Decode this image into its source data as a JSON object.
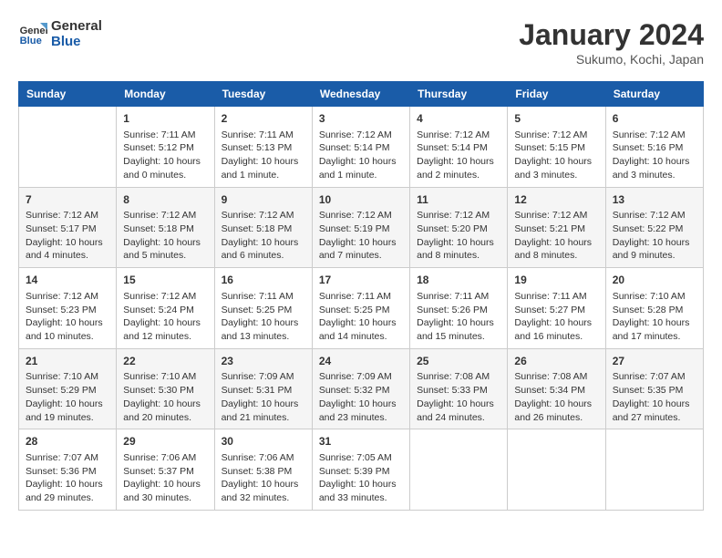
{
  "header": {
    "logo_line1": "General",
    "logo_line2": "Blue",
    "main_title": "January 2024",
    "subtitle": "Sukumo, Kochi, Japan"
  },
  "days_of_week": [
    "Sunday",
    "Monday",
    "Tuesday",
    "Wednesday",
    "Thursday",
    "Friday",
    "Saturday"
  ],
  "weeks": [
    [
      {
        "day": "",
        "info": ""
      },
      {
        "day": "1",
        "info": "Sunrise: 7:11 AM\nSunset: 5:12 PM\nDaylight: 10 hours\nand 0 minutes."
      },
      {
        "day": "2",
        "info": "Sunrise: 7:11 AM\nSunset: 5:13 PM\nDaylight: 10 hours\nand 1 minute."
      },
      {
        "day": "3",
        "info": "Sunrise: 7:12 AM\nSunset: 5:14 PM\nDaylight: 10 hours\nand 1 minute."
      },
      {
        "day": "4",
        "info": "Sunrise: 7:12 AM\nSunset: 5:14 PM\nDaylight: 10 hours\nand 2 minutes."
      },
      {
        "day": "5",
        "info": "Sunrise: 7:12 AM\nSunset: 5:15 PM\nDaylight: 10 hours\nand 3 minutes."
      },
      {
        "day": "6",
        "info": "Sunrise: 7:12 AM\nSunset: 5:16 PM\nDaylight: 10 hours\nand 3 minutes."
      }
    ],
    [
      {
        "day": "7",
        "info": "Sunrise: 7:12 AM\nSunset: 5:17 PM\nDaylight: 10 hours\nand 4 minutes."
      },
      {
        "day": "8",
        "info": "Sunrise: 7:12 AM\nSunset: 5:18 PM\nDaylight: 10 hours\nand 5 minutes."
      },
      {
        "day": "9",
        "info": "Sunrise: 7:12 AM\nSunset: 5:18 PM\nDaylight: 10 hours\nand 6 minutes."
      },
      {
        "day": "10",
        "info": "Sunrise: 7:12 AM\nSunset: 5:19 PM\nDaylight: 10 hours\nand 7 minutes."
      },
      {
        "day": "11",
        "info": "Sunrise: 7:12 AM\nSunset: 5:20 PM\nDaylight: 10 hours\nand 8 minutes."
      },
      {
        "day": "12",
        "info": "Sunrise: 7:12 AM\nSunset: 5:21 PM\nDaylight: 10 hours\nand 8 minutes."
      },
      {
        "day": "13",
        "info": "Sunrise: 7:12 AM\nSunset: 5:22 PM\nDaylight: 10 hours\nand 9 minutes."
      }
    ],
    [
      {
        "day": "14",
        "info": "Sunrise: 7:12 AM\nSunset: 5:23 PM\nDaylight: 10 hours\nand 10 minutes."
      },
      {
        "day": "15",
        "info": "Sunrise: 7:12 AM\nSunset: 5:24 PM\nDaylight: 10 hours\nand 12 minutes."
      },
      {
        "day": "16",
        "info": "Sunrise: 7:11 AM\nSunset: 5:25 PM\nDaylight: 10 hours\nand 13 minutes."
      },
      {
        "day": "17",
        "info": "Sunrise: 7:11 AM\nSunset: 5:25 PM\nDaylight: 10 hours\nand 14 minutes."
      },
      {
        "day": "18",
        "info": "Sunrise: 7:11 AM\nSunset: 5:26 PM\nDaylight: 10 hours\nand 15 minutes."
      },
      {
        "day": "19",
        "info": "Sunrise: 7:11 AM\nSunset: 5:27 PM\nDaylight: 10 hours\nand 16 minutes."
      },
      {
        "day": "20",
        "info": "Sunrise: 7:10 AM\nSunset: 5:28 PM\nDaylight: 10 hours\nand 17 minutes."
      }
    ],
    [
      {
        "day": "21",
        "info": "Sunrise: 7:10 AM\nSunset: 5:29 PM\nDaylight: 10 hours\nand 19 minutes."
      },
      {
        "day": "22",
        "info": "Sunrise: 7:10 AM\nSunset: 5:30 PM\nDaylight: 10 hours\nand 20 minutes."
      },
      {
        "day": "23",
        "info": "Sunrise: 7:09 AM\nSunset: 5:31 PM\nDaylight: 10 hours\nand 21 minutes."
      },
      {
        "day": "24",
        "info": "Sunrise: 7:09 AM\nSunset: 5:32 PM\nDaylight: 10 hours\nand 23 minutes."
      },
      {
        "day": "25",
        "info": "Sunrise: 7:08 AM\nSunset: 5:33 PM\nDaylight: 10 hours\nand 24 minutes."
      },
      {
        "day": "26",
        "info": "Sunrise: 7:08 AM\nSunset: 5:34 PM\nDaylight: 10 hours\nand 26 minutes."
      },
      {
        "day": "27",
        "info": "Sunrise: 7:07 AM\nSunset: 5:35 PM\nDaylight: 10 hours\nand 27 minutes."
      }
    ],
    [
      {
        "day": "28",
        "info": "Sunrise: 7:07 AM\nSunset: 5:36 PM\nDaylight: 10 hours\nand 29 minutes."
      },
      {
        "day": "29",
        "info": "Sunrise: 7:06 AM\nSunset: 5:37 PM\nDaylight: 10 hours\nand 30 minutes."
      },
      {
        "day": "30",
        "info": "Sunrise: 7:06 AM\nSunset: 5:38 PM\nDaylight: 10 hours\nand 32 minutes."
      },
      {
        "day": "31",
        "info": "Sunrise: 7:05 AM\nSunset: 5:39 PM\nDaylight: 10 hours\nand 33 minutes."
      },
      {
        "day": "",
        "info": ""
      },
      {
        "day": "",
        "info": ""
      },
      {
        "day": "",
        "info": ""
      }
    ]
  ]
}
